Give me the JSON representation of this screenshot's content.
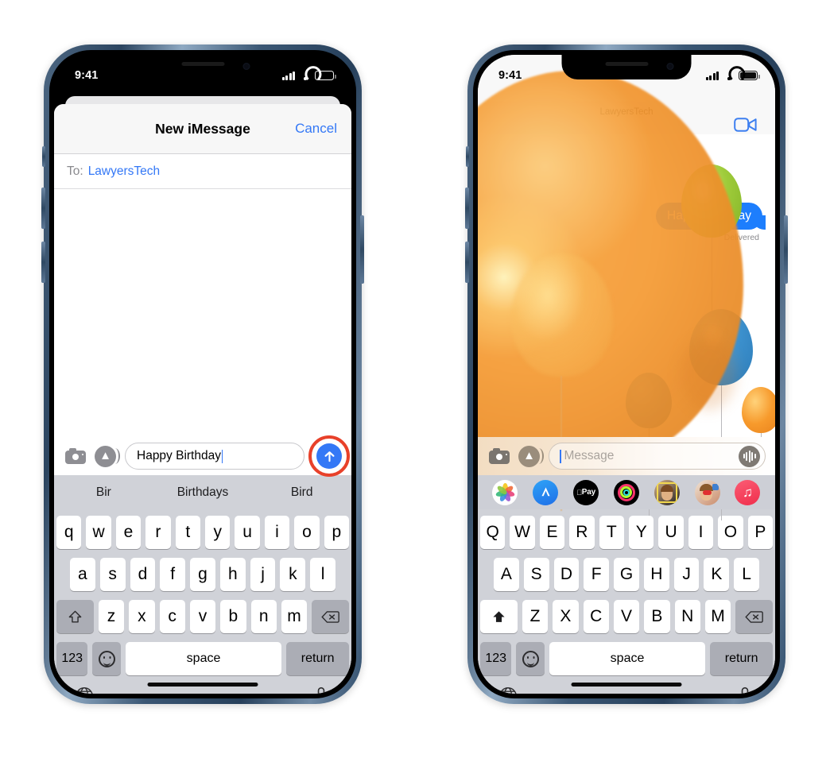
{
  "left_phone": {
    "status_bar": {
      "time": "9:41",
      "cellular": "signal-bars",
      "wifi": "wifi",
      "battery": "battery-empty"
    },
    "sheet": {
      "title": "New iMessage",
      "cancel_label": "Cancel",
      "to_label": "To:",
      "to_value": "LawyersTech"
    },
    "input": {
      "camera_icon": "camera-icon",
      "apps_icon": "app-store-icon",
      "value": "Happy Birthday",
      "send_icon": "send-arrow-up-icon",
      "annotation": "red-highlight-ring"
    },
    "predictive": [
      "Bir",
      "Birthdays",
      "Bird"
    ],
    "keyboard": {
      "row1": [
        "q",
        "w",
        "e",
        "r",
        "t",
        "y",
        "u",
        "i",
        "o",
        "p"
      ],
      "row2": [
        "a",
        "s",
        "d",
        "f",
        "g",
        "h",
        "j",
        "k",
        "l"
      ],
      "row3": [
        "z",
        "x",
        "c",
        "v",
        "b",
        "n",
        "m"
      ],
      "shift_icon": "shift-outline-icon",
      "delete_icon": "delete-backward-icon",
      "numbers_label": "123",
      "emoji_icon": "emoji-smiley-icon",
      "space_label": "space",
      "return_label": "return",
      "globe_icon": "globe-icon",
      "mic_icon": "microphone-icon"
    }
  },
  "right_phone": {
    "status_bar": {
      "time": "9:41",
      "cellular": "signal-bars",
      "wifi": "wifi",
      "battery": "battery-full"
    },
    "conversation": {
      "contact_name": "LawyersTech",
      "facetime_icon": "video-camera-icon",
      "message_text": "Happy Birthday",
      "delivery_status": "Delivered",
      "effect": "balloons-screen-effect"
    },
    "input": {
      "camera_icon": "camera-icon",
      "apps_icon": "app-store-icon",
      "placeholder": "Message",
      "audio_icon": "audio-waveform-icon"
    },
    "app_strip": [
      {
        "name": "photos-app-icon",
        "label": ""
      },
      {
        "name": "app-store-app-icon",
        "label": "A"
      },
      {
        "name": "apple-pay-app-icon",
        "label": "Pay"
      },
      {
        "name": "fitness-app-icon",
        "label": ""
      },
      {
        "name": "memoji-app-icon",
        "label": ""
      },
      {
        "name": "memoji-stickers-app-icon",
        "label": ""
      },
      {
        "name": "music-app-icon",
        "label": "♫"
      }
    ],
    "keyboard": {
      "row1": [
        "Q",
        "W",
        "E",
        "R",
        "T",
        "Y",
        "U",
        "I",
        "O",
        "P"
      ],
      "row2": [
        "A",
        "S",
        "D",
        "F",
        "G",
        "H",
        "J",
        "K",
        "L"
      ],
      "row3": [
        "Z",
        "X",
        "C",
        "V",
        "B",
        "N",
        "M"
      ],
      "shift_icon": "shift-filled-icon",
      "delete_icon": "delete-backward-icon",
      "numbers_label": "123",
      "emoji_icon": "emoji-smiley-icon",
      "space_label": "space",
      "return_label": "return",
      "globe_icon": "globe-icon",
      "mic_icon": "microphone-icon"
    }
  },
  "colors": {
    "accent_blue": "#3478f6",
    "bubble_blue": "#1d7efd",
    "annotation_red": "#e8412a",
    "keyboard_bg": "#d0d2d8",
    "balloon_orange": "#f59a33"
  }
}
